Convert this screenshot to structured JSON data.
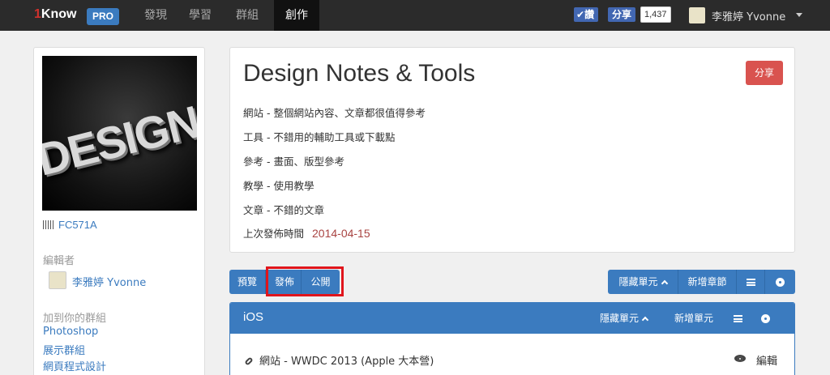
{
  "nav": {
    "logo_num": "1",
    "logo_text": "Know",
    "pro_badge": "PRO",
    "items": [
      {
        "label": "發現"
      },
      {
        "label": "學習"
      },
      {
        "label": "群組"
      },
      {
        "label": "創作"
      }
    ],
    "active": "創作",
    "fb_like": "讚",
    "fb_share": "分享",
    "fb_count": "1,437",
    "user_name": "李雅婷 Yvonne"
  },
  "sidebar": {
    "cover_word": "DESIGN",
    "code": "FC571A",
    "editor_label": "編輯者",
    "editor_name": "李雅婷 Yvonne",
    "groups_label": "加到你的群組",
    "groups": [
      "Photoshop",
      "展示群組",
      "網頁程式設計"
    ]
  },
  "header": {
    "title": "Design Notes & Tools",
    "share_label": "分享",
    "lines": [
      "網站 - 整個網站內容、文章都很值得參考",
      "工具 - 不錯用的輔助工具或下載點",
      "參考 - 畫面、版型參考",
      "教學 - 使用教學",
      "文章 - 不錯的文章"
    ],
    "published_label": "上次發佈時間",
    "published_date": "2014-04-15"
  },
  "toolbar": {
    "preview": "預覽",
    "publish": "發佈",
    "public": "公開",
    "hide_units": "隱藏單元",
    "add_chapter": "新增章節"
  },
  "section": {
    "title": "iOS",
    "hide_units": "隱藏單元",
    "add_unit": "新增單元",
    "item_label": "網站 - WWDC 2013 (Apple 大本營)",
    "edit_label": "編輯"
  }
}
